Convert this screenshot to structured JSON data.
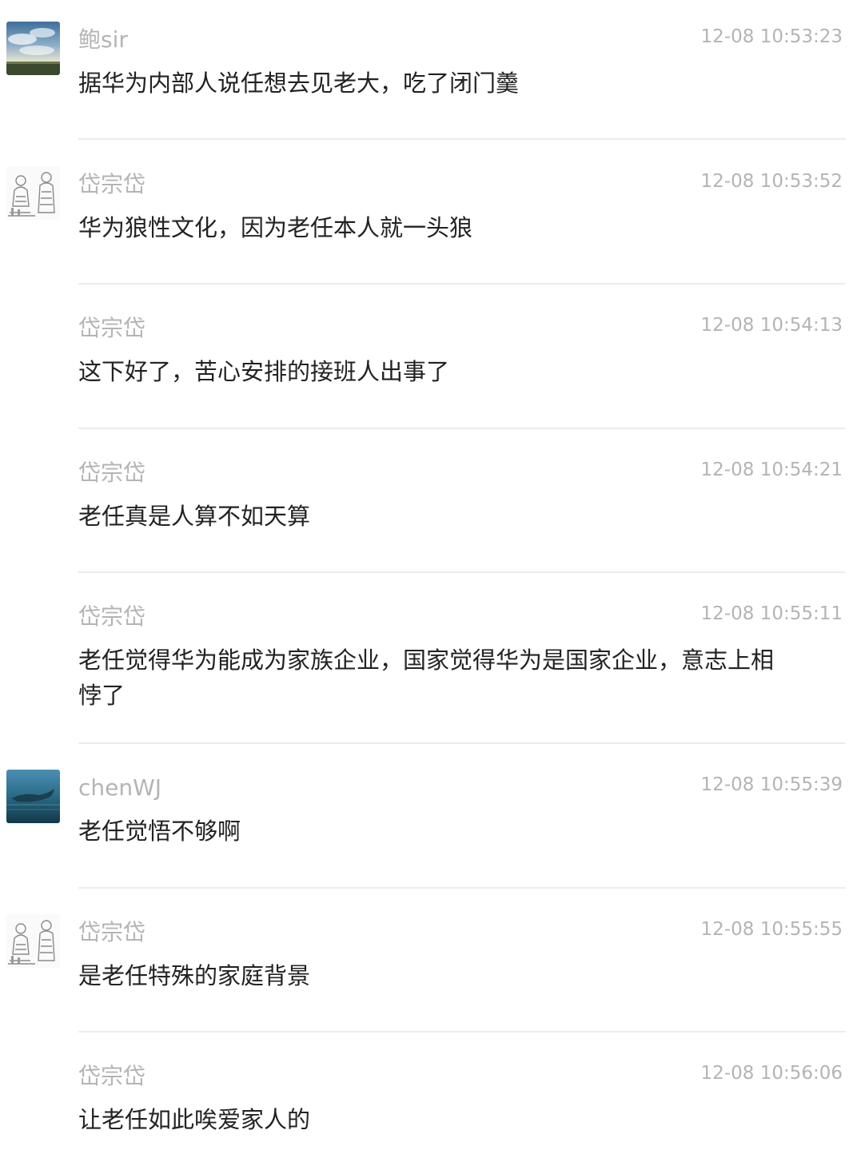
{
  "comments": [
    {
      "avatar": "sky-clouds-avatar",
      "author": "鲍sir",
      "time": "12-08 10:53:23",
      "text": "据华为内部人说任想去见老大，吃了闭门羹"
    },
    {
      "avatar": "sketch-figures-avatar",
      "author": "岱宗岱",
      "time": "12-08 10:53:52",
      "text": "华为狼性文化，因为老任本人就一头狼"
    },
    {
      "avatar": "",
      "author": "岱宗岱",
      "time": "12-08 10:54:13",
      "text": "这下好了，苦心安排的接班人出事了"
    },
    {
      "avatar": "",
      "author": "岱宗岱",
      "time": "12-08 10:54:21",
      "text": "老任真是人算不如天算"
    },
    {
      "avatar": "",
      "author": "岱宗岱",
      "time": "12-08 10:55:11",
      "text": "老任觉得华为能成为家族企业，国家觉得华为是国家企业，意志上相悖了"
    },
    {
      "avatar": "whale-ocean-avatar",
      "author": "chenWJ",
      "time": "12-08 10:55:39",
      "text": "老任觉悟不够啊"
    },
    {
      "avatar": "sketch-figures-avatar",
      "author": "岱宗岱",
      "time": "12-08 10:55:55",
      "text": "是老任特殊的家庭背景"
    },
    {
      "avatar": "",
      "author": "岱宗岱",
      "time": "12-08 10:56:06",
      "text": "让老任如此唉爱家人的"
    }
  ]
}
